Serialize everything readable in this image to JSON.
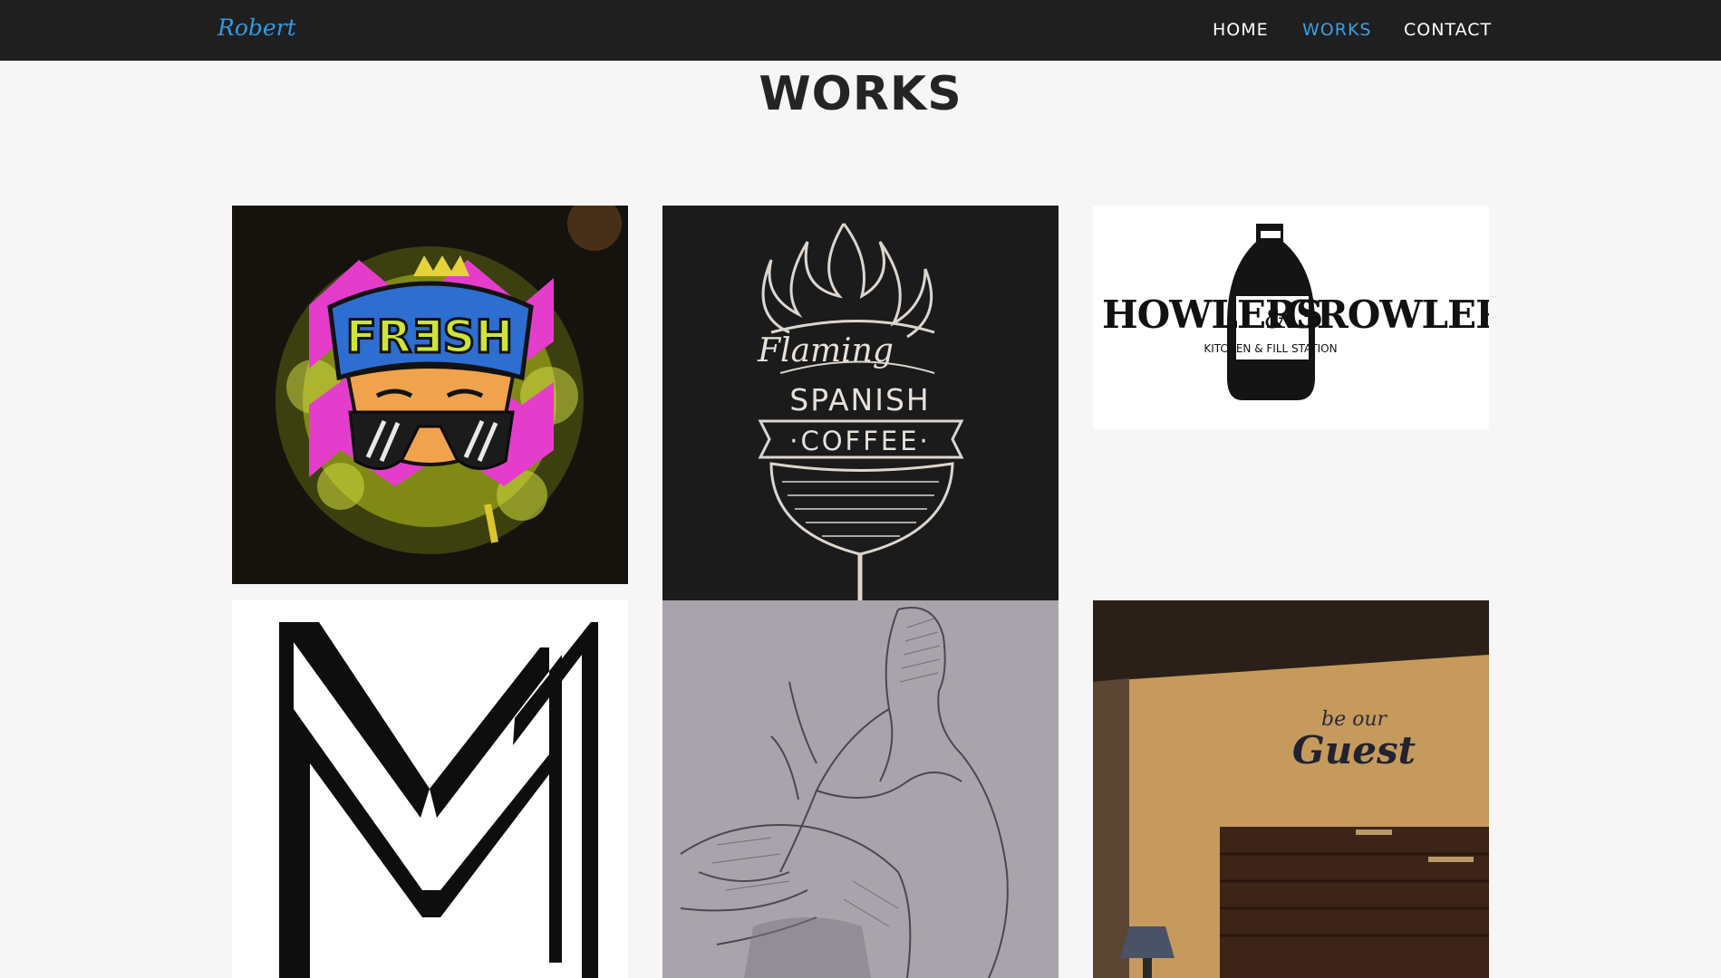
{
  "navbar": {
    "brand": "Robert",
    "links": [
      {
        "label": "HOME",
        "active": false
      },
      {
        "label": "WORKS",
        "active": true
      },
      {
        "label": "CONTACT",
        "active": false
      }
    ],
    "active_color": "#3a9ee4",
    "background_color": "#1f1f1f"
  },
  "page": {
    "title": "WORKS"
  },
  "works": [
    {
      "name": "Fresh",
      "lettering": "FRƎSH"
    },
    {
      "name": "Flaming Spanish Coffee",
      "lettering": [
        "Flaming",
        "SPANISH",
        "COFFEE"
      ]
    },
    {
      "name": "Howlers & Growlers",
      "lettering": [
        "HOWLERS",
        "&",
        "GROWLERS",
        "KITCHEN & FILL STATION"
      ]
    },
    {
      "name": "M monogram"
    },
    {
      "name": "Figure sketch"
    },
    {
      "name": "Be our Guest",
      "lettering": [
        "be our",
        "Guest"
      ]
    }
  ]
}
